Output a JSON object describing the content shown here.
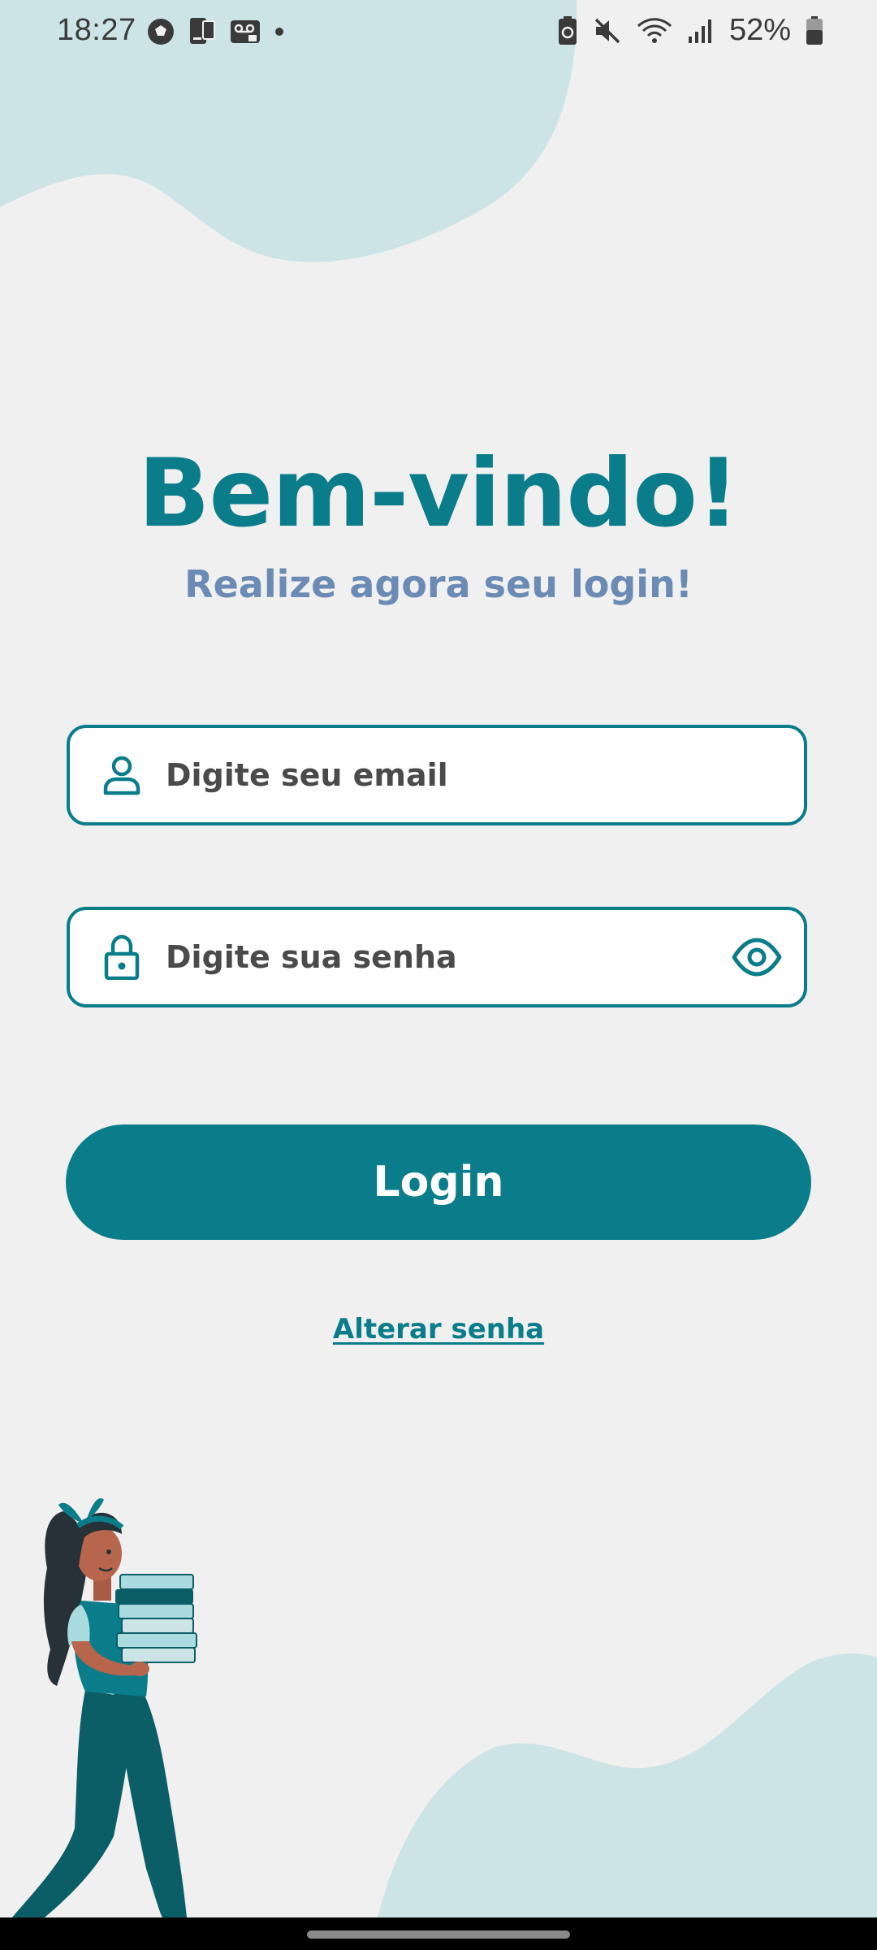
{
  "status_bar": {
    "time": "18:27",
    "battery": "52%",
    "left_icons": [
      "soccer-ball-icon",
      "phone-sync-icon",
      "voicemail-icon",
      "dot-icon"
    ],
    "right_icons": [
      "battery-saver-icon",
      "mute-icon",
      "wifi-icon",
      "signal-icon",
      "battery-icon"
    ]
  },
  "welcome": {
    "title": "Bem-vindo!",
    "subtitle": "Realize agora seu login!"
  },
  "email_field": {
    "placeholder": "Digite seu email",
    "value": "",
    "icon": "user-icon"
  },
  "password_field": {
    "placeholder": "Digite sua senha",
    "value": "",
    "icon": "lock-icon",
    "toggle_icon": "eye-icon"
  },
  "login_button": {
    "label": "Login"
  },
  "change_password_link": {
    "label": "Alterar senha"
  },
  "colors": {
    "primary": "#0b7d8a",
    "subtitle": "#6b8bb4",
    "background": "#f0f0f0",
    "blob": "#cde4e7"
  }
}
